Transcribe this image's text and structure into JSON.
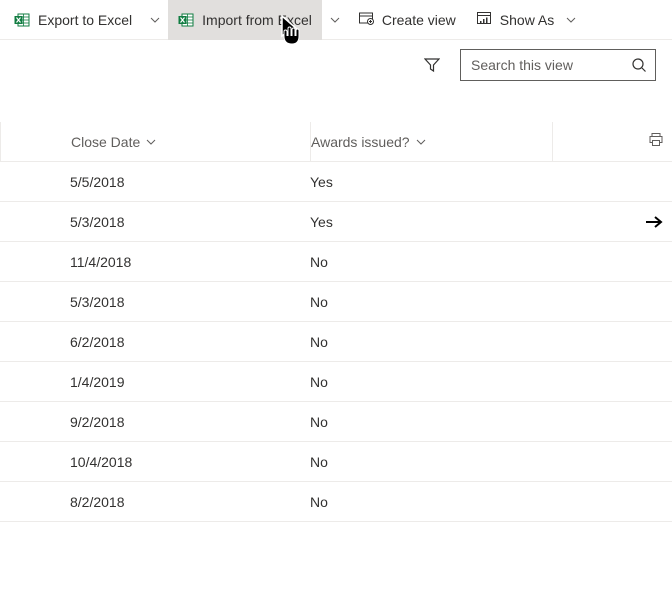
{
  "toolbar": {
    "export_label": "Export to Excel",
    "import_label": "Import from Excel",
    "create_view_label": "Create view",
    "show_as_label": "Show As"
  },
  "search": {
    "placeholder": "Search this view"
  },
  "columns": {
    "close_date": "Close Date",
    "awards_issued": "Awards issued?"
  },
  "rows": [
    {
      "close_date": "5/5/2018",
      "awards_issued": "Yes",
      "active": false
    },
    {
      "close_date": "5/3/2018",
      "awards_issued": "Yes",
      "active": true
    },
    {
      "close_date": "11/4/2018",
      "awards_issued": "No",
      "active": false
    },
    {
      "close_date": "5/3/2018",
      "awards_issued": "No",
      "active": false
    },
    {
      "close_date": "6/2/2018",
      "awards_issued": "No",
      "active": false
    },
    {
      "close_date": "1/4/2019",
      "awards_issued": "No",
      "active": false
    },
    {
      "close_date": "9/2/2018",
      "awards_issued": "No",
      "active": false
    },
    {
      "close_date": "10/4/2018",
      "awards_issued": "No",
      "active": false
    },
    {
      "close_date": "8/2/2018",
      "awards_issued": "No",
      "active": false
    }
  ]
}
